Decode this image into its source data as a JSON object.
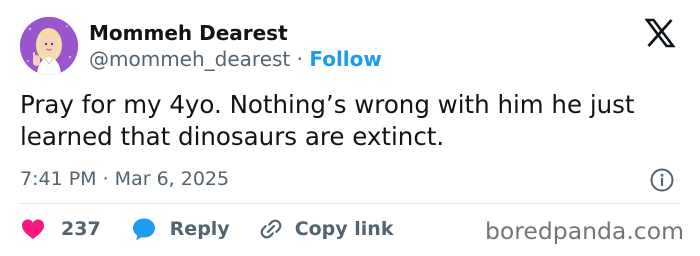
{
  "author": {
    "display_name": "Mommeh Dearest",
    "handle": "@mommeh_dearest",
    "separator": "·",
    "follow_label": "Follow"
  },
  "tweet": {
    "text": "Pray for my 4yo. Nothing’s wrong with him he just learned that dinosaurs are extinct.",
    "timestamp": "7:41 PM · Mar 6, 2025"
  },
  "actions": {
    "likes_count": "237",
    "reply_label": "Reply",
    "copy_link_label": "Copy link"
  },
  "watermark": "boredpanda.com",
  "icons": {
    "brand": "x-logo-icon",
    "info": "info-icon",
    "like": "heart-icon",
    "reply": "speech-bubble-icon",
    "copy": "link-icon"
  },
  "colors": {
    "link": "#1d9bf0",
    "like": "#f91880",
    "secondary_text": "#536471",
    "avatar_bg": "#9b56cf"
  }
}
